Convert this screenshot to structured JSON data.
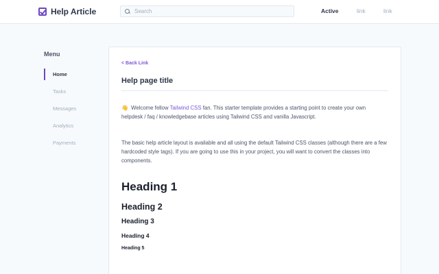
{
  "header": {
    "brand_title": "Help Article",
    "search_placeholder": "Search",
    "nav_links": [
      "Active",
      "link",
      "link"
    ]
  },
  "sidebar": {
    "menu_title": "Menu",
    "items": [
      "Home",
      "Tasks",
      "Messages",
      "Analytics",
      "Payments"
    ],
    "active_item": "Home"
  },
  "content": {
    "back_link": "< Back Link",
    "page_title": "Help page title",
    "para1": {
      "emoji": "👋",
      "before": " Welcome fellow ",
      "link": "Tailwind CSS",
      "after": " fan. This starter template provides a starting point to create your own helpdesk / faq / knowledgebase articles using Tailwind CSS and vanilla Javascript."
    },
    "para2": "The basic help article layout is available and all using the default Tailwind CSS classes (although there are a few hardcoded style tags). If you are going to use this in your project, you will want to convert the classes into components.",
    "headings": [
      "Heading 1",
      "Heading 2",
      "Heading 3",
      "Heading 4",
      "Heading 5"
    ]
  },
  "colors": {
    "accent": "#6b46c1",
    "link": "#805ad5",
    "background": "#f7fafc"
  }
}
